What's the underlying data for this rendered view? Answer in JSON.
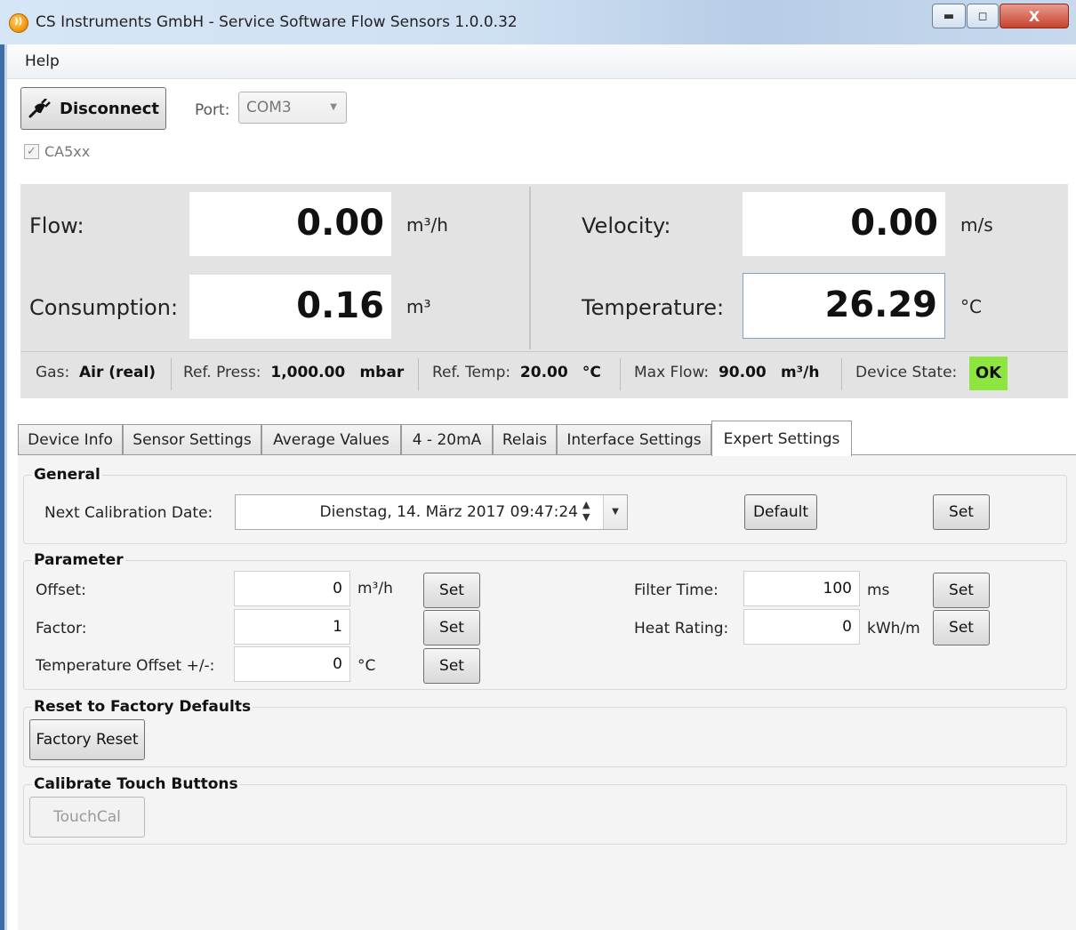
{
  "window": {
    "title": "CS Instruments GmbH - Service Software Flow Sensors  1.0.0.32",
    "close_glyph": "X"
  },
  "menu": {
    "help": "Help"
  },
  "connection": {
    "disconnect_label": "Disconnect",
    "port_label": "Port:",
    "port_value": "COM3",
    "checkbox_label": "CA5xx",
    "checkbox_checked": true
  },
  "measurements": {
    "flow": {
      "label": "Flow:",
      "value": "0.00",
      "unit": "m³/h"
    },
    "velocity": {
      "label": "Velocity:",
      "value": "0.00",
      "unit": "m/s"
    },
    "consumption": {
      "label": "Consumption:",
      "value": "0.16",
      "unit": "m³"
    },
    "temperature": {
      "label": "Temperature:",
      "value": "26.29",
      "unit": "°C"
    }
  },
  "status": {
    "gas_label": "Gas:",
    "gas_value": "Air (real)",
    "ref_press_label": "Ref. Press:",
    "ref_press_value": "1,000.00",
    "ref_press_unit": "mbar",
    "ref_temp_label": "Ref. Temp:",
    "ref_temp_value": "20.00",
    "ref_temp_unit": "°C",
    "max_flow_label": "Max Flow:",
    "max_flow_value": "90.00",
    "max_flow_unit": "m³/h",
    "device_state_label": "Device State:",
    "device_state_value": "OK",
    "device_state_color": "#8ee53f"
  },
  "tabs": [
    {
      "label": "Device Info"
    },
    {
      "label": "Sensor Settings"
    },
    {
      "label": "Average Values"
    },
    {
      "label": "4 - 20mA"
    },
    {
      "label": "Relais"
    },
    {
      "label": "Interface Settings"
    },
    {
      "label": "Expert Settings",
      "active": true
    }
  ],
  "general": {
    "title": "General",
    "next_cal_label": "Next Calibration Date:",
    "next_cal_value": "Dienstag, 14. März 2017 09:47:24",
    "default_label": "Default",
    "set_label": "Set"
  },
  "parameter": {
    "title": "Parameter",
    "offset_label": "Offset:",
    "offset_value": "0",
    "offset_unit": "m³/h",
    "factor_label": "Factor:",
    "factor_value": "1",
    "temp_offset_label": "Temperature Offset +/-:",
    "temp_offset_value": "0",
    "temp_offset_unit": "°C",
    "filter_time_label": "Filter Time:",
    "filter_time_value": "100",
    "filter_time_unit": "ms",
    "heat_rating_label": "Heat Rating:",
    "heat_rating_value": "0",
    "heat_rating_unit": "kWh/m",
    "set_label": "Set"
  },
  "reset": {
    "title": "Reset to Factory Defaults",
    "button_label": "Factory Reset"
  },
  "touch": {
    "title": "Calibrate Touch Buttons",
    "button_label": "TouchCal"
  }
}
